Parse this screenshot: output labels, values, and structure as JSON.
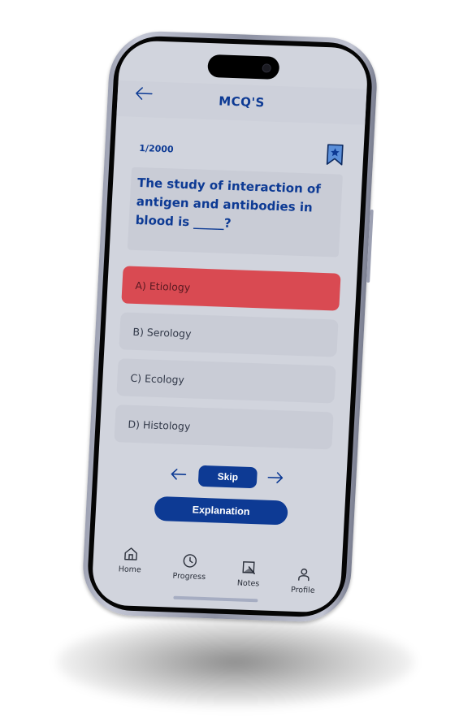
{
  "header": {
    "title": "MCQ'S",
    "back_icon": "arrow-left-icon"
  },
  "question": {
    "counter": "1/2000",
    "text": "The study of interaction of antigen and antibodies in blood is _____?",
    "bookmark_icon": "bookmark-star-icon"
  },
  "options": [
    {
      "label": "A) Etiology",
      "selected": true
    },
    {
      "label": "B) Serology",
      "selected": false
    },
    {
      "label": "C) Ecology",
      "selected": false
    },
    {
      "label": "D) Histology",
      "selected": false
    }
  ],
  "navigation": {
    "prev_icon": "arrow-left-icon",
    "next_icon": "arrow-right-icon",
    "skip_label": "Skip",
    "explanation_label": "Explanation"
  },
  "bottom_nav": {
    "items": [
      {
        "label": "Home",
        "icon": "home-icon"
      },
      {
        "label": "Progress",
        "icon": "clock-icon"
      },
      {
        "label": "Notes",
        "icon": "notes-icon"
      },
      {
        "label": "Profile",
        "icon": "user-icon"
      }
    ]
  },
  "colors": {
    "primary": "#0d3a94",
    "selected_option": "#d94a52",
    "screen_bg": "#d1d4dd",
    "card_bg": "#c9ccd6"
  }
}
